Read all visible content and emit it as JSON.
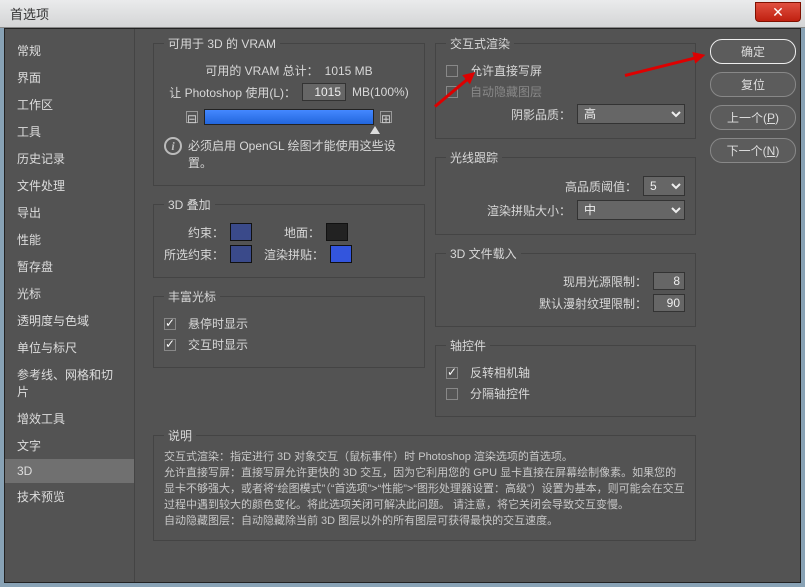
{
  "window": {
    "title": "首选项"
  },
  "sidebar": {
    "items": [
      {
        "label": "常规"
      },
      {
        "label": "界面"
      },
      {
        "label": "工作区"
      },
      {
        "label": "工具"
      },
      {
        "label": "历史记录"
      },
      {
        "label": "文件处理"
      },
      {
        "label": "导出"
      },
      {
        "label": "性能"
      },
      {
        "label": "暂存盘"
      },
      {
        "label": "光标"
      },
      {
        "label": "透明度与色域"
      },
      {
        "label": "单位与标尺"
      },
      {
        "label": "参考线、网格和切片"
      },
      {
        "label": "增效工具"
      },
      {
        "label": "文字"
      },
      {
        "label": "3D"
      },
      {
        "label": "技术预览"
      }
    ],
    "selected": 15
  },
  "vram": {
    "legend": "可用于 3D 的 VRAM",
    "total_label": "可用的 VRAM 总计：",
    "total_value": "1015 MB",
    "use_label": "让 Photoshop 使用(L)：",
    "use_value": "1015",
    "use_suffix": "MB(100%)",
    "note": "必须启用 OpenGL 绘图才能使用这些设置。"
  },
  "overlay3d": {
    "legend": "3D 叠加",
    "constraint_label": "约束：",
    "ground_label": "地面：",
    "sel_constraint_label": "所选约束：",
    "render_tiles_label": "渲染拼贴："
  },
  "cursors": {
    "legend": "丰富光标",
    "hover": "悬停时显示",
    "interact": "交互时显示"
  },
  "interactive": {
    "legend": "交互式渲染",
    "direct": "允许直接写屏",
    "autohide": "自动隐藏图层",
    "shadow_label": "阴影品质：",
    "shadow_value": "高"
  },
  "raytrace": {
    "legend": "光线跟踪",
    "threshold_label": "高品质阈值：",
    "threshold_value": "5",
    "tiles_label": "渲染拼贴大小：",
    "tiles_value": "中"
  },
  "fileload": {
    "legend": "3D 文件载入",
    "lights_label": "现用光源限制：",
    "lights_value": "8",
    "textures_label": "默认漫射纹理限制：",
    "textures_value": "90"
  },
  "axis": {
    "legend": "轴控件",
    "reverse": "反转相机轴",
    "separate": "分隔轴控件"
  },
  "desc": {
    "legend": "说明",
    "text": "交互式渲染：指定进行 3D 对象交互（鼠标事件）时 Photoshop 渲染选项的首选项。\n允许直接写屏：直接写屏允许更快的 3D 交互，因为它利用您的 GPU 显卡直接在屏幕绘制像素。如果您的显卡不够强大，或者将“绘图模式”（“首选项”>“性能”>“图形处理器设置：高级”）设置为基本，则可能会在交互过程中遇到较大的颜色变化。将此选项关闭可解决此问题。 请注意，将它关闭会导致交互变慢。\n自动隐藏图层：自动隐藏除当前 3D 图层以外的所有图层可获得最快的交互速度。"
  },
  "buttons": {
    "ok": "确定",
    "reset": "复位",
    "prev": "上一个(P)",
    "next": "下一个(N)"
  }
}
